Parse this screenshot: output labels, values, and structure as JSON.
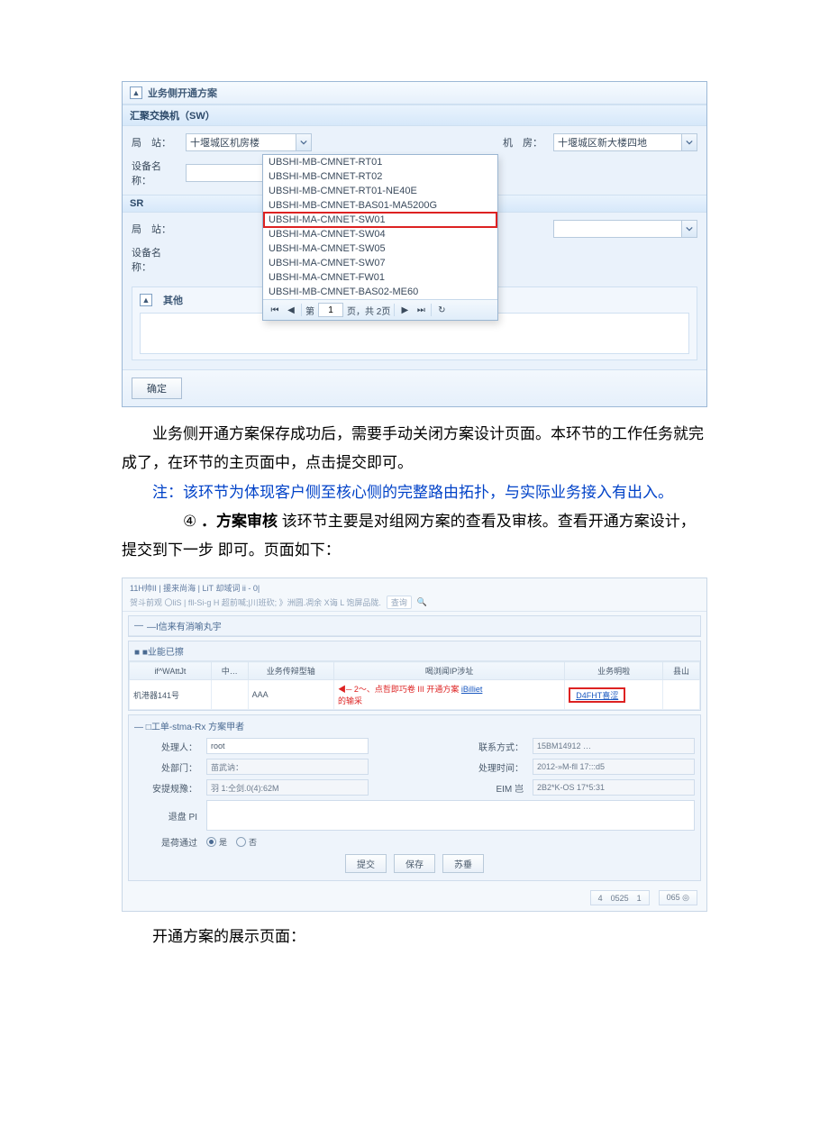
{
  "screenshot1": {
    "collapse_glyph": "▲",
    "title": "业务侧开通方案",
    "section_sw": "汇聚交换机（SW）",
    "section_sr": "SR",
    "label_station": "局　站：",
    "label_device": "设备名称：",
    "label_room": "机　房：",
    "combo_station_value": "十堰城区机房楼",
    "combo_room_value": "十堰城区新大楼四地",
    "dropdown_options": [
      "UBSHI-MB-CMNET-RT01",
      "UBSHI-MB-CMNET-RT02",
      "UBSHI-MB-CMNET-RT01-NE40E",
      "UBSHI-MB-CMNET-BAS01-MA5200G",
      "UBSHI-MA-CMNET-SW01",
      "UBSHI-MA-CMNET-SW04",
      "UBSHI-MA-CMNET-SW05",
      "UBSHI-MA-CMNET-SW07",
      "UBSHI-MA-CMNET-FW01",
      "UBSHI-MB-CMNET-BAS02-ME60"
    ],
    "dropdown_highlight_index": 4,
    "pager_prefix": "第",
    "pager_page": "1",
    "pager_suffix": "页，共 2页",
    "other_title": "其他",
    "confirm": "确定"
  },
  "para1_a": "业务侧开通方案保存成功后，需要手动关闭方案设计页面。本环节的工作任务就完成了，在环节的主页面中，点击提交即可。",
  "para_note_label": "注：",
  "para_note_text": "该环节为体现客户侧至核心侧的完整路由拓扑，与实际业务接入有出入。",
  "para2_num": "④",
  "para2_head": "．方案审核",
  "para2_body_a": " 该环节主要是对组网方案的查看及审核。查看开通方案设计，提交到下一步 即可。页面如下：",
  "screenshot2": {
    "top_line1": "11H帅II | 援来尚海 | LiT 却域词 ii - 0|",
    "top_line2_a": "贺斗前观 〇liS | fll-Si-g H 超前喊;|川班砍; 》洲圆.凋余 X诲 L 饱屏品陇.",
    "top_line2_btn": "查询",
    "panel1_h": "—I信来有消喻丸宇",
    "panel2_h": "■ ■业能已擦",
    "table_headers": [
      "if^WAttJt",
      "中…",
      "业务传辩型轴",
      "喝浏闻IP涉址",
      "业务明啦",
      "县山"
    ],
    "table_row": {
      "c1": "机港器141号",
      "c2": "",
      "c3": "AAA",
      "c4_ann_a": "2〜、点哲即巧卷 III 开通方案",
      "c4_ann_b": "的输采",
      "c4_link_frag": "iBilliet",
      "c5_link": "D4FHT喜涩",
      "c6": ""
    },
    "panel3_h": "— □工单-stma-Rx 方案甲者",
    "form": {
      "lab_person": "处理人：",
      "val_person": "root",
      "lab_contact": "联系方式：",
      "val_contact": "15BM14912 …",
      "lab_dept": "处部门：",
      "val_dept": "苗武讷：",
      "lab_time": "处理时间：",
      "val_time": "2012-»M-fll 17:::d5",
      "lab_limit": "安提规豫：",
      "val_limit": "羽 1:仝剑.0(4):62M",
      "lab_eim": "EIM 岂",
      "val_eim": "2B2*K-OS 17*5:31",
      "lab_pi": "退盘 PI",
      "lab_pass": "是荷通过",
      "radio_yes": "是",
      "radio_no": "否"
    },
    "buttons": {
      "submit": "提交",
      "save": "保存",
      "back": "  ",
      "misc": "苏垂"
    },
    "footer": {
      "left": "4　0525　1",
      "right": "065   ◎"
    }
  },
  "caption2": "开通方案的展示页面："
}
